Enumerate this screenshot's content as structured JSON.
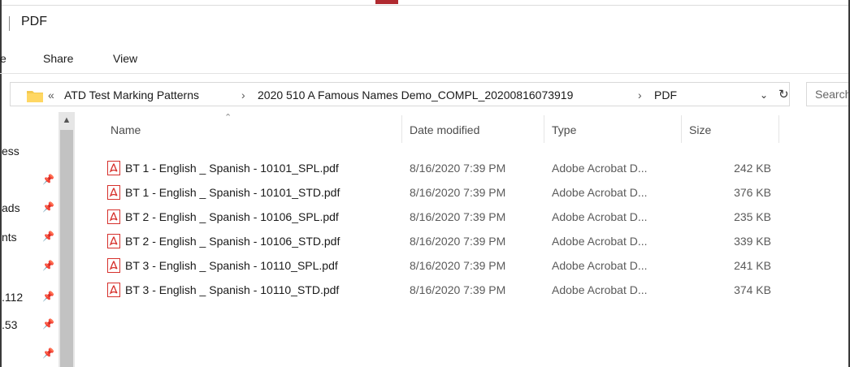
{
  "window": {
    "title": "PDF",
    "accent_color": "#b02a30"
  },
  "ribbon": {
    "tabs": [
      {
        "label": "e"
      },
      {
        "label": "Share"
      },
      {
        "label": "View"
      }
    ]
  },
  "address_bar": {
    "overflow_glyph": "«",
    "crumbs": [
      {
        "label": "ATD Test Marking Patterns"
      },
      {
        "label": "2020 510 A Famous Names Demo_COMPL_20200816073919"
      },
      {
        "label": "PDF"
      }
    ],
    "separator": "›",
    "search_placeholder": "Search"
  },
  "nav_pane": {
    "items": [
      {
        "label": "ess",
        "pinned": false
      },
      {
        "label": "",
        "pinned": true
      },
      {
        "label": "ads",
        "pinned": true
      },
      {
        "label": "nts",
        "pinned": true
      },
      {
        "label": "",
        "pinned": true
      },
      {
        "label": ".112",
        "pinned": true
      },
      {
        "label": ".53",
        "pinned": true
      },
      {
        "label": "",
        "pinned": true
      }
    ]
  },
  "columns": {
    "name": "Name",
    "date": "Date modified",
    "type": "Type",
    "size": "Size"
  },
  "files": [
    {
      "name": "BT 1 - English _ Spanish - 10101_SPL.pdf",
      "date": "8/16/2020 7:39 PM",
      "type": "Adobe Acrobat D...",
      "size": "242 KB"
    },
    {
      "name": "BT 1 - English _ Spanish - 10101_STD.pdf",
      "date": "8/16/2020 7:39 PM",
      "type": "Adobe Acrobat D...",
      "size": "376 KB"
    },
    {
      "name": "BT 2 - English _ Spanish - 10106_SPL.pdf",
      "date": "8/16/2020 7:39 PM",
      "type": "Adobe Acrobat D...",
      "size": "235 KB"
    },
    {
      "name": "BT 2 - English _ Spanish - 10106_STD.pdf",
      "date": "8/16/2020 7:39 PM",
      "type": "Adobe Acrobat D...",
      "size": "339 KB"
    },
    {
      "name": "BT 3 - English _ Spanish - 10110_SPL.pdf",
      "date": "8/16/2020 7:39 PM",
      "type": "Adobe Acrobat D...",
      "size": "241 KB"
    },
    {
      "name": "BT 3 - English _ Spanish - 10110_STD.pdf",
      "date": "8/16/2020 7:39 PM",
      "type": "Adobe Acrobat D...",
      "size": "374 KB"
    }
  ],
  "icons": {
    "folder": "folder-icon",
    "pdf": "pdf-file-icon",
    "pin": "pin-icon",
    "refresh": "refresh-icon",
    "dropdown": "chevron-down-icon",
    "sort": "sort-ascending-icon"
  }
}
